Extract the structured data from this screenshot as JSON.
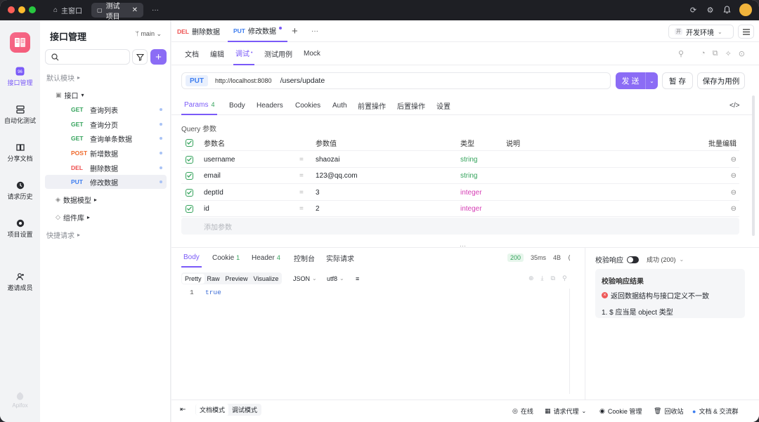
{
  "titlebar": {
    "home_tab": "主窗口",
    "project_tab": "测试项目",
    "more": "···"
  },
  "rail": {
    "items": [
      {
        "label": "接口管理",
        "icon": "api-icon"
      },
      {
        "label": "自动化测试",
        "icon": "automation-icon"
      },
      {
        "label": "分享文档",
        "icon": "share-doc-icon"
      },
      {
        "label": "请求历史",
        "icon": "history-icon"
      },
      {
        "label": "项目设置",
        "icon": "settings-icon"
      },
      {
        "label": "邀请成员",
        "icon": "invite-icon"
      }
    ],
    "brand": "Apifox"
  },
  "sidebar": {
    "title": "接口管理",
    "branch": "main",
    "default_module": "默认模块",
    "folder": "接口",
    "items": [
      {
        "method": "GET",
        "name": "查询列表"
      },
      {
        "method": "GET",
        "name": "查询分页"
      },
      {
        "method": "GET",
        "name": "查询单条数据"
      },
      {
        "method": "POST",
        "name": "新增数据"
      },
      {
        "method": "DEL",
        "name": "删除数据"
      },
      {
        "method": "PUT",
        "name": "修改数据"
      }
    ],
    "data_model": "数据模型",
    "components": "组件库",
    "quick_request": "快捷请求"
  },
  "doc_tabs": [
    {
      "method": "DEL",
      "name": "删除数据"
    },
    {
      "method": "PUT",
      "name": "修改数据"
    }
  ],
  "env": "开发环境",
  "env_badge": "开",
  "subtabs": [
    "文档",
    "编辑",
    "调试",
    "测试用例",
    "Mock"
  ],
  "request": {
    "method": "PUT",
    "host": "http://localhost:8080",
    "path": "/users/update",
    "send": "发 送",
    "save": "暂 存",
    "save_case": "保存为用例"
  },
  "param_tabs": {
    "params": "Params",
    "params_count": "4",
    "others": [
      "Body",
      "Headers",
      "Cookies",
      "Auth",
      "前置操作",
      "后置操作",
      "设置"
    ]
  },
  "query": {
    "section": "Query 参数",
    "headers": {
      "name": "参数名",
      "value": "参数值",
      "type": "类型",
      "desc": "说明",
      "bulk": "批量编辑"
    },
    "rows": [
      {
        "name": "username",
        "value": "shaozai",
        "type": "string"
      },
      {
        "name": "email",
        "value": "123@qq.com",
        "type": "string"
      },
      {
        "name": "deptId",
        "value": "3",
        "type": "integer"
      },
      {
        "name": "id",
        "value": "2",
        "type": "integer"
      }
    ],
    "add": "添加参数"
  },
  "response": {
    "tabs": [
      {
        "label": "Body",
        "count": ""
      },
      {
        "label": "Cookie",
        "count": "1"
      },
      {
        "label": "Header",
        "count": "4"
      },
      {
        "label": "控制台",
        "count": ""
      },
      {
        "label": "实际请求",
        "count": ""
      }
    ],
    "status": "200",
    "time": "35ms",
    "size": "4B",
    "formats": [
      "Pretty",
      "Raw",
      "Preview",
      "Visualize"
    ],
    "lang": "JSON",
    "encoding": "utf8",
    "line_no": "1",
    "body": "true"
  },
  "validation": {
    "label": "校验响应",
    "result": "成功 (200)",
    "title": "校验响应结果",
    "error": "返回数据结构与接口定义不一致",
    "detail": "1. $ 应当是 object 类型"
  },
  "bottom": {
    "doc_mode": "文档模式",
    "debug_mode": "调试模式",
    "online": "在线",
    "proxy": "请求代理",
    "cookie": "Cookie 管理",
    "recycle": "回收站",
    "community": "文档 & 交流群"
  }
}
